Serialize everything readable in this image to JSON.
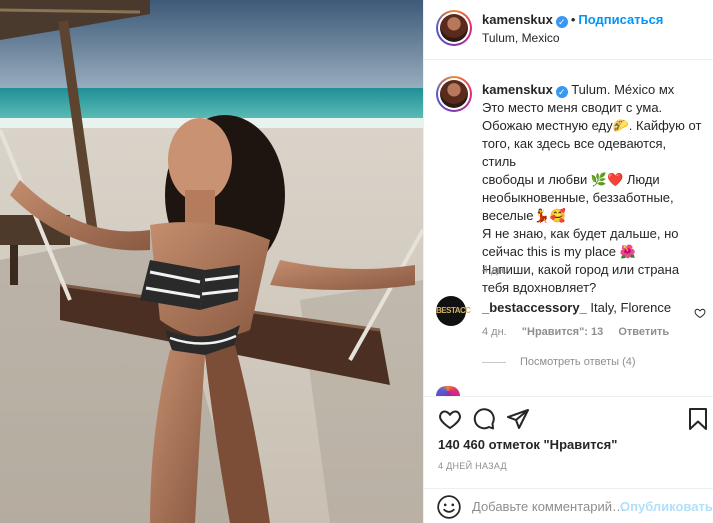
{
  "post": {
    "username": "kamenskux",
    "follow_label": "Подписаться",
    "separator": "•",
    "location": "Tulum, Mexico"
  },
  "caption": {
    "username": "kamenskux",
    "location_text": "Tulum. México мх",
    "lines": [
      "Это место меня сводит с ума.",
      "Обожаю местную еду🌮. Кайфую от",
      "того, как здесь все одеваются, стиль",
      "свободы и любви 🌿❤️ Люди",
      "необыкновенные, беззаботные,",
      "веселые💃🥰",
      "Я не знаю, как будет дальше, но",
      "сейчас this is my place 🌺",
      "Напиши, какой город или страна",
      "тебя вдохновляет?"
    ],
    "time": "4 дн."
  },
  "comment": {
    "avatar_text": "BESTACC",
    "username": "_bestaccessory_",
    "text": " Italy, Florence",
    "time": "4 дн.",
    "likes": "\"Нравится\": 13",
    "reply": "Ответить",
    "view_replies": "Посмотреть ответы (4)"
  },
  "actions": {
    "likes": "140 460 отметок \"Нравится\"",
    "ago": "4 ДНЕЙ НАЗАД"
  },
  "add_comment": {
    "placeholder": "Добавьте комментарий…",
    "publish": "Опубликовать"
  },
  "icons": [
    "heart-icon",
    "comment-icon",
    "share-icon",
    "bookmark-icon",
    "emoji-icon",
    "verified-icon",
    "small-heart-icon"
  ],
  "colors": {
    "accent": "#0095f6",
    "verified": "#3897f0",
    "muted": "#8e8e8e",
    "publish_disabled": "#b2dffc"
  }
}
